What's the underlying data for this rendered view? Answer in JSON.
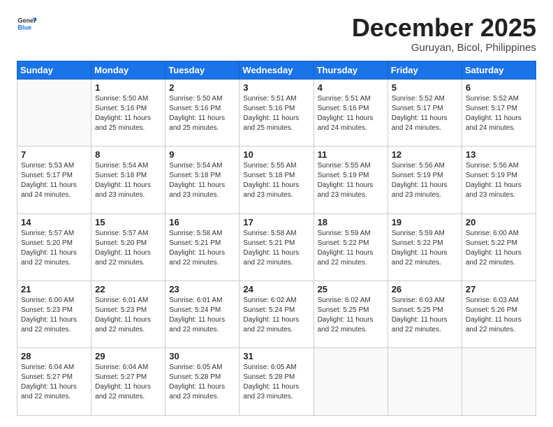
{
  "logo": {
    "general": "General",
    "blue": "Blue"
  },
  "header": {
    "month": "December 2025",
    "location": "Guruyan, Bicol, Philippines"
  },
  "weekdays": [
    "Sunday",
    "Monday",
    "Tuesday",
    "Wednesday",
    "Thursday",
    "Friday",
    "Saturday"
  ],
  "weeks": [
    [
      {
        "day": "",
        "info": ""
      },
      {
        "day": "1",
        "info": "Sunrise: 5:50 AM\nSunset: 5:16 PM\nDaylight: 11 hours\nand 25 minutes."
      },
      {
        "day": "2",
        "info": "Sunrise: 5:50 AM\nSunset: 5:16 PM\nDaylight: 11 hours\nand 25 minutes."
      },
      {
        "day": "3",
        "info": "Sunrise: 5:51 AM\nSunset: 5:16 PM\nDaylight: 11 hours\nand 25 minutes."
      },
      {
        "day": "4",
        "info": "Sunrise: 5:51 AM\nSunset: 5:16 PM\nDaylight: 11 hours\nand 24 minutes."
      },
      {
        "day": "5",
        "info": "Sunrise: 5:52 AM\nSunset: 5:17 PM\nDaylight: 11 hours\nand 24 minutes."
      },
      {
        "day": "6",
        "info": "Sunrise: 5:52 AM\nSunset: 5:17 PM\nDaylight: 11 hours\nand 24 minutes."
      }
    ],
    [
      {
        "day": "7",
        "info": "Sunrise: 5:53 AM\nSunset: 5:17 PM\nDaylight: 11 hours\nand 24 minutes."
      },
      {
        "day": "8",
        "info": "Sunrise: 5:54 AM\nSunset: 5:18 PM\nDaylight: 11 hours\nand 23 minutes."
      },
      {
        "day": "9",
        "info": "Sunrise: 5:54 AM\nSunset: 5:18 PM\nDaylight: 11 hours\nand 23 minutes."
      },
      {
        "day": "10",
        "info": "Sunrise: 5:55 AM\nSunset: 5:18 PM\nDaylight: 11 hours\nand 23 minutes."
      },
      {
        "day": "11",
        "info": "Sunrise: 5:55 AM\nSunset: 5:19 PM\nDaylight: 11 hours\nand 23 minutes."
      },
      {
        "day": "12",
        "info": "Sunrise: 5:56 AM\nSunset: 5:19 PM\nDaylight: 11 hours\nand 23 minutes."
      },
      {
        "day": "13",
        "info": "Sunrise: 5:56 AM\nSunset: 5:19 PM\nDaylight: 11 hours\nand 23 minutes."
      }
    ],
    [
      {
        "day": "14",
        "info": "Sunrise: 5:57 AM\nSunset: 5:20 PM\nDaylight: 11 hours\nand 22 minutes."
      },
      {
        "day": "15",
        "info": "Sunrise: 5:57 AM\nSunset: 5:20 PM\nDaylight: 11 hours\nand 22 minutes."
      },
      {
        "day": "16",
        "info": "Sunrise: 5:58 AM\nSunset: 5:21 PM\nDaylight: 11 hours\nand 22 minutes."
      },
      {
        "day": "17",
        "info": "Sunrise: 5:58 AM\nSunset: 5:21 PM\nDaylight: 11 hours\nand 22 minutes."
      },
      {
        "day": "18",
        "info": "Sunrise: 5:59 AM\nSunset: 5:22 PM\nDaylight: 11 hours\nand 22 minutes."
      },
      {
        "day": "19",
        "info": "Sunrise: 5:59 AM\nSunset: 5:22 PM\nDaylight: 11 hours\nand 22 minutes."
      },
      {
        "day": "20",
        "info": "Sunrise: 6:00 AM\nSunset: 5:22 PM\nDaylight: 11 hours\nand 22 minutes."
      }
    ],
    [
      {
        "day": "21",
        "info": "Sunrise: 6:00 AM\nSunset: 5:23 PM\nDaylight: 11 hours\nand 22 minutes."
      },
      {
        "day": "22",
        "info": "Sunrise: 6:01 AM\nSunset: 5:23 PM\nDaylight: 11 hours\nand 22 minutes."
      },
      {
        "day": "23",
        "info": "Sunrise: 6:01 AM\nSunset: 5:24 PM\nDaylight: 11 hours\nand 22 minutes."
      },
      {
        "day": "24",
        "info": "Sunrise: 6:02 AM\nSunset: 5:24 PM\nDaylight: 11 hours\nand 22 minutes."
      },
      {
        "day": "25",
        "info": "Sunrise: 6:02 AM\nSunset: 5:25 PM\nDaylight: 11 hours\nand 22 minutes."
      },
      {
        "day": "26",
        "info": "Sunrise: 6:03 AM\nSunset: 5:25 PM\nDaylight: 11 hours\nand 22 minutes."
      },
      {
        "day": "27",
        "info": "Sunrise: 6:03 AM\nSunset: 5:26 PM\nDaylight: 11 hours\nand 22 minutes."
      }
    ],
    [
      {
        "day": "28",
        "info": "Sunrise: 6:04 AM\nSunset: 5:27 PM\nDaylight: 11 hours\nand 22 minutes."
      },
      {
        "day": "29",
        "info": "Sunrise: 6:04 AM\nSunset: 5:27 PM\nDaylight: 11 hours\nand 22 minutes."
      },
      {
        "day": "30",
        "info": "Sunrise: 6:05 AM\nSunset: 5:28 PM\nDaylight: 11 hours\nand 23 minutes."
      },
      {
        "day": "31",
        "info": "Sunrise: 6:05 AM\nSunset: 5:28 PM\nDaylight: 11 hours\nand 23 minutes."
      },
      {
        "day": "",
        "info": ""
      },
      {
        "day": "",
        "info": ""
      },
      {
        "day": "",
        "info": ""
      }
    ]
  ]
}
